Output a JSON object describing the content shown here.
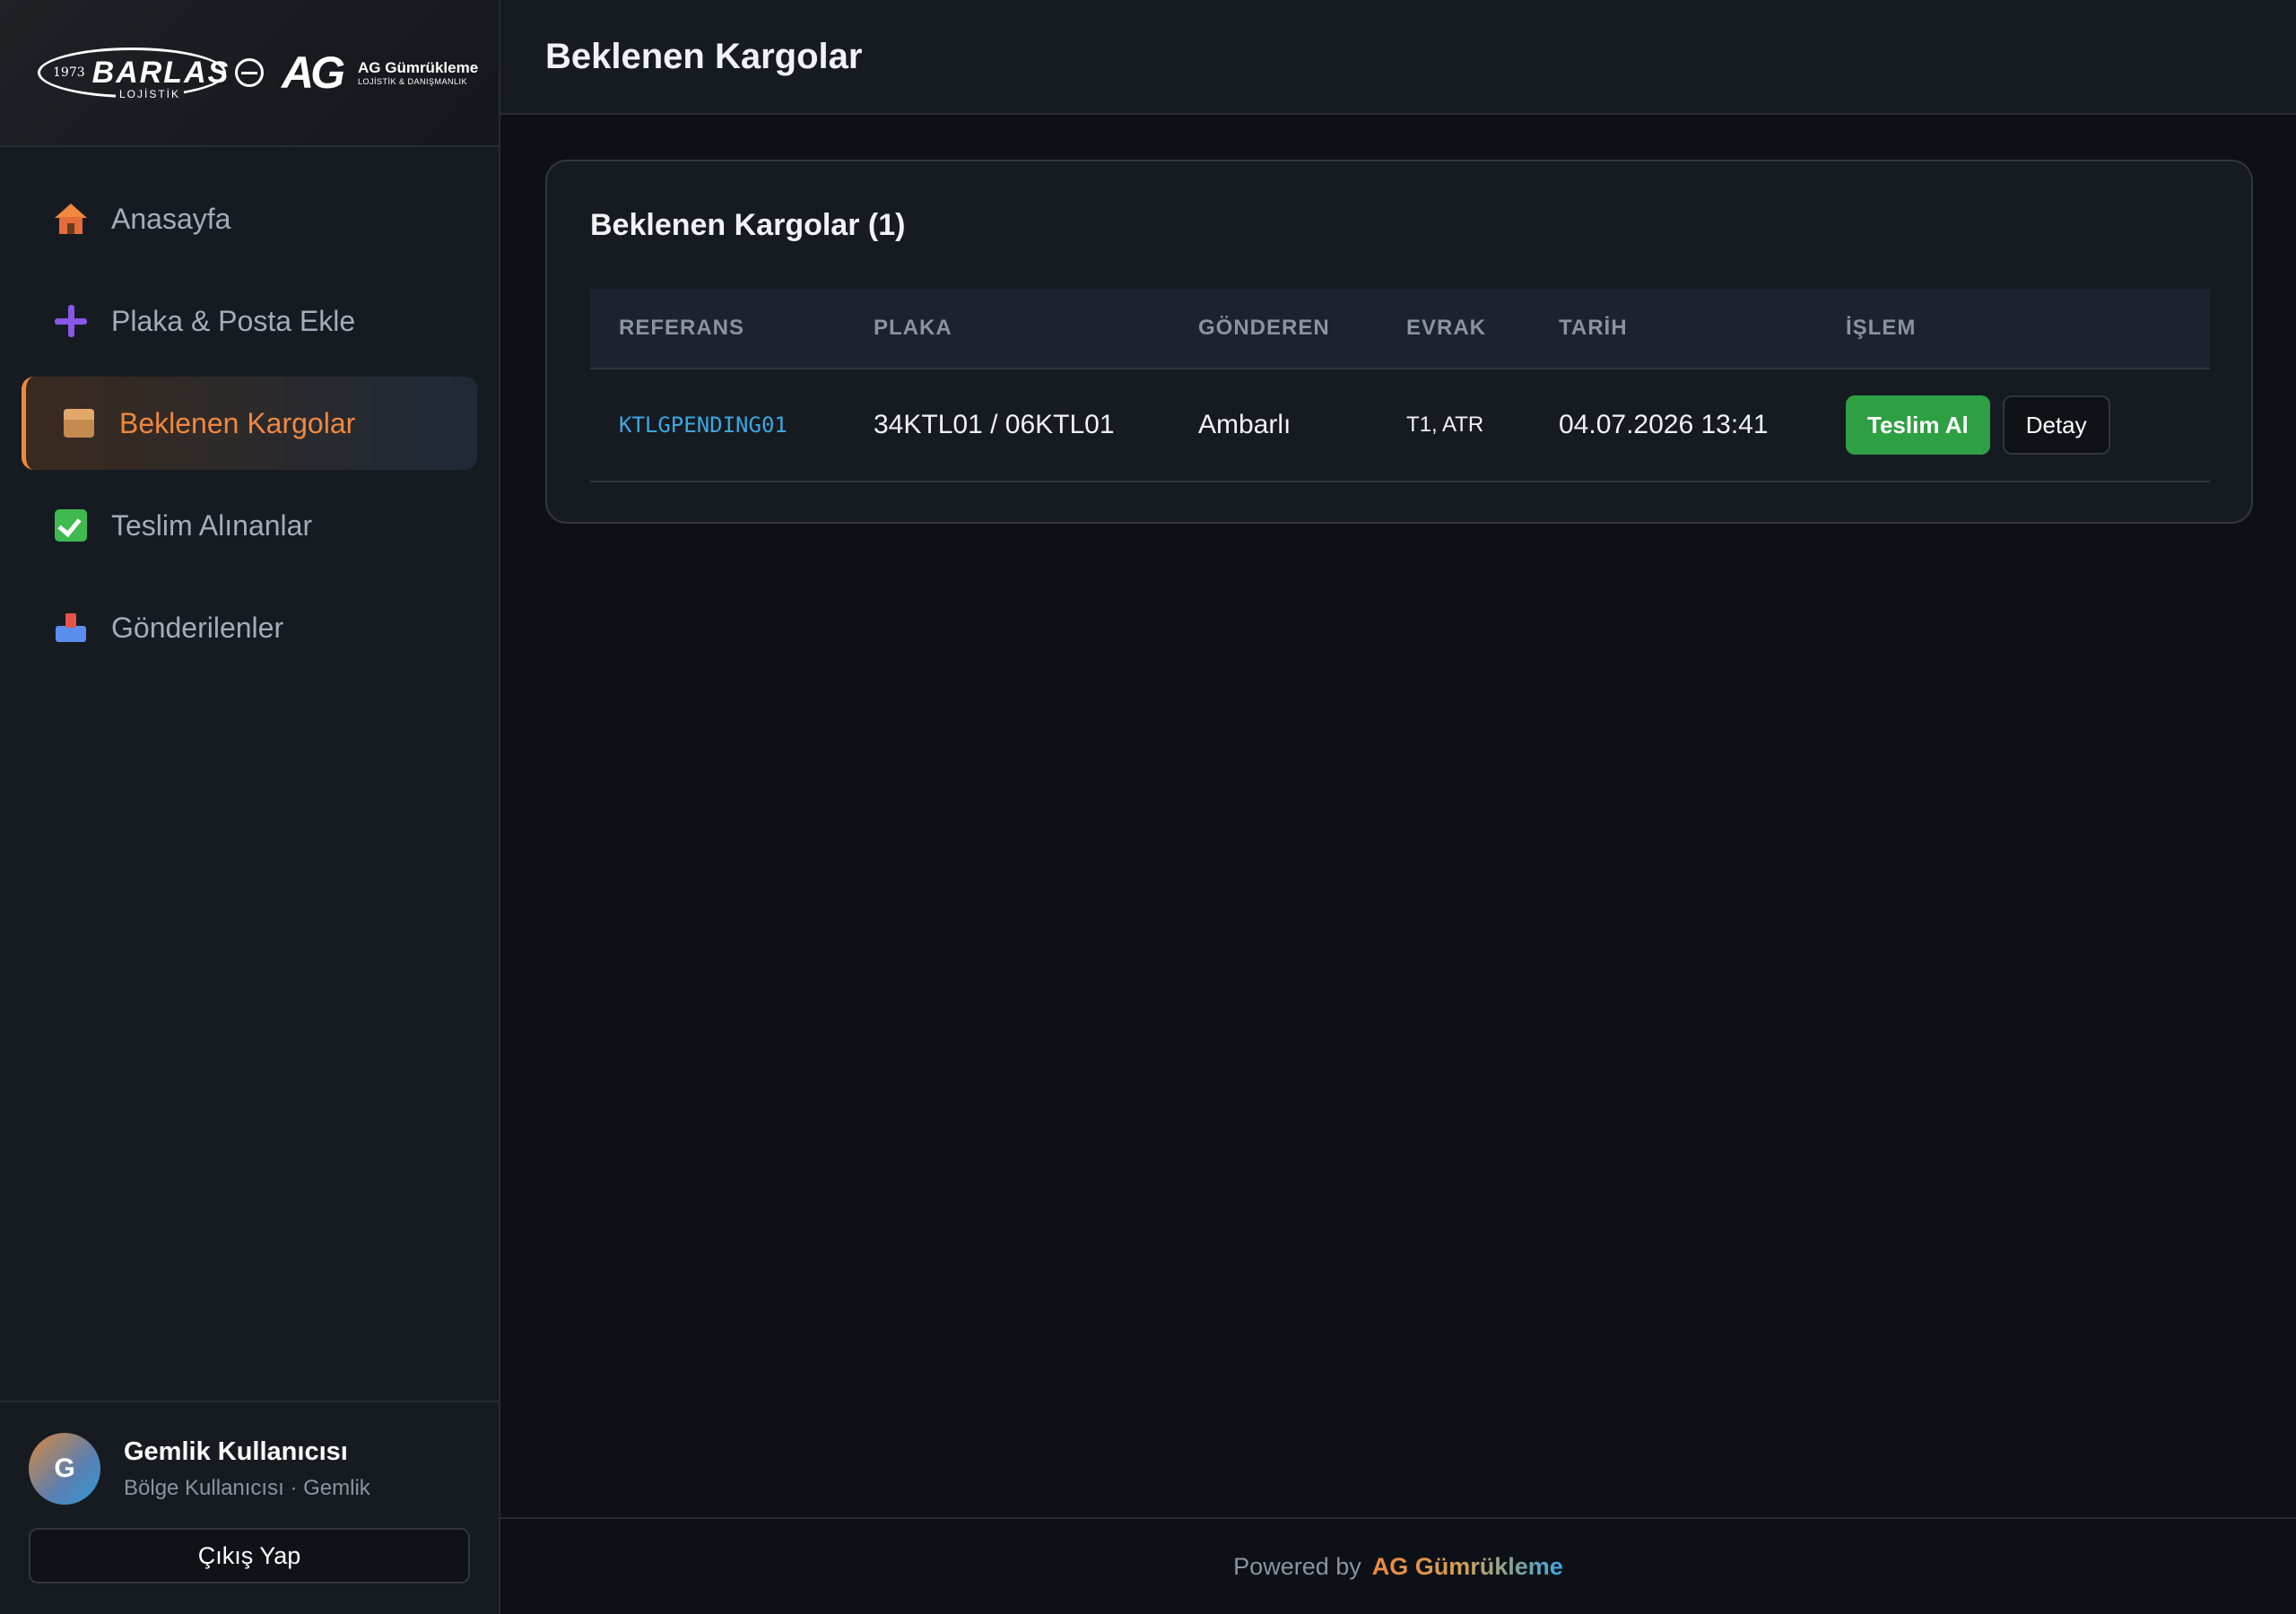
{
  "brand": {
    "barlas_year": "1973",
    "barlas_name": "BARLAS",
    "barlas_sub": "LOJİSTİK",
    "ag_mark": "AG",
    "ag_name": "AG Gümrükleme",
    "ag_desc": "LOJİSTİK & DANIŞMANLIK"
  },
  "sidebar": {
    "items": [
      {
        "label": "Anasayfa",
        "icon": "home-icon"
      },
      {
        "label": "Plaka & Posta Ekle",
        "icon": "plus-icon"
      },
      {
        "label": "Beklenen Kargolar",
        "icon": "package-icon",
        "active": true
      },
      {
        "label": "Teslim Alınanlar",
        "icon": "check-icon"
      },
      {
        "label": "Gönderilenler",
        "icon": "outbox-icon"
      }
    ]
  },
  "user": {
    "initial": "G",
    "name": "Gemlik Kullanıcısı",
    "role": "Bölge Kullanıcısı · Gemlik",
    "logout_label": "Çıkış Yap"
  },
  "header": {
    "title": "Beklenen Kargolar"
  },
  "card": {
    "title": "Beklenen Kargolar (1)"
  },
  "table": {
    "columns": [
      "REFERANS",
      "PLAKA",
      "GÖNDEREN",
      "EVRAK",
      "TARİH",
      "İŞLEM"
    ],
    "rows": [
      {
        "referans": "KTLGPENDING01",
        "plaka": "34KTL01 / 06KTL01",
        "gonderen": "Ambarlı",
        "evrak": "T1, ATR",
        "tarih": "04.07.2026 13:41",
        "action_primary": "Teslim Al",
        "action_secondary": "Detay"
      }
    ]
  },
  "footer": {
    "prefix": "Powered by",
    "brand": "AG Gümrükleme"
  },
  "colors": {
    "background": "#0d1117",
    "sidebar": "#161b22",
    "accent": "#f0883e",
    "success": "#2ea043",
    "link": "#3ea6e0"
  }
}
